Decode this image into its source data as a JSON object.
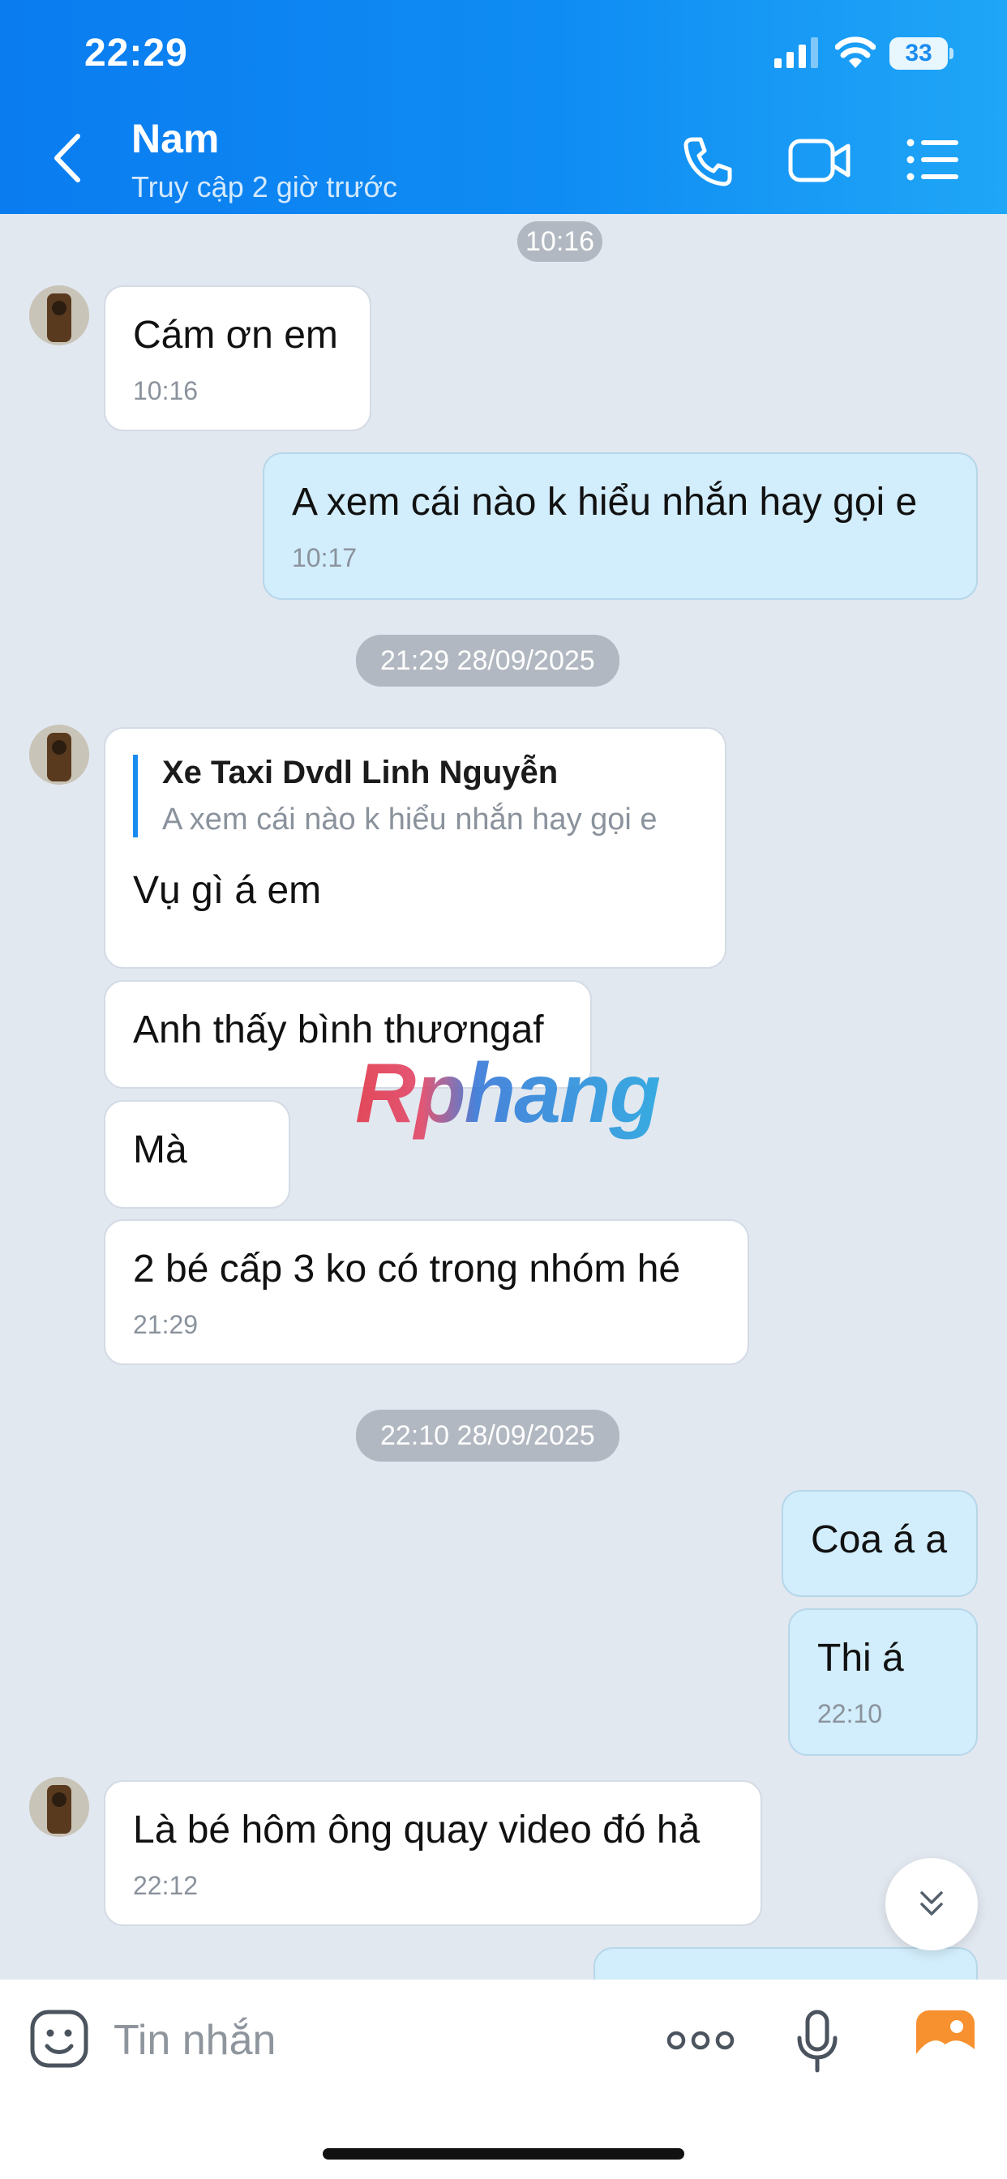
{
  "status_bar": {
    "time": "22:29",
    "battery": "33"
  },
  "header": {
    "contact_name": "Nam",
    "contact_status": "Truy cập 2 giờ trước"
  },
  "messages": [
    {
      "type": "time",
      "text": "10:16"
    },
    {
      "type": "in",
      "text": "Cám ơn em",
      "time": "10:16"
    },
    {
      "type": "out",
      "text": "A xem cái nào k hiểu nhắn hay gọi e",
      "time": "10:17"
    },
    {
      "type": "time",
      "text": "21:29 28/09/2025"
    },
    {
      "type": "in",
      "reply_name": "Xe Taxi Dvdl Linh Nguyễn",
      "reply_text": "A xem cái nào k hiểu nhắn hay gọi e",
      "text": "Vụ gì á em"
    },
    {
      "type": "in",
      "text": "Anh thấy bình thươngaf"
    },
    {
      "type": "in",
      "text": "Mà"
    },
    {
      "type": "in",
      "text": "2 bé cấp 3 ko có trong nhóm hé",
      "time": "21:29"
    },
    {
      "type": "time",
      "text": "22:10 28/09/2025"
    },
    {
      "type": "out",
      "text": "Coa á a"
    },
    {
      "type": "out",
      "text": "Thi á",
      "time": "22:10"
    },
    {
      "type": "in",
      "text": "Là bé hôm ông quay video đó hả",
      "time": "22:12"
    }
  ],
  "watermark": "Rphang",
  "input": {
    "placeholder": "Tin nhắn"
  },
  "colors": {
    "header_start": "#0a7cf0",
    "header_end": "#1fa6f7",
    "chat_bg": "#e2e8f0",
    "out_bubble": "#d2edfb",
    "in_bubble": "#ffffff",
    "accent": "#1a8cf0",
    "photo_button": "#f7902e"
  }
}
